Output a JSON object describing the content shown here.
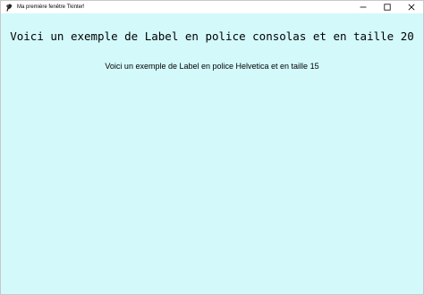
{
  "window": {
    "title": "Ma première fenêtre Tkinter!",
    "app_icon": "tk-feather-icon",
    "background_color": "#d3f9fb"
  },
  "controls": {
    "minimize_icon": "minimize-icon",
    "maximize_icon": "maximize-icon",
    "close_icon": "close-icon"
  },
  "labels": {
    "consolas_text": "Voici un exemple de Label en police consolas et en taille 20",
    "helvetica_text": "Voici un exemple de Label en police Helvetica et en taille 15"
  }
}
